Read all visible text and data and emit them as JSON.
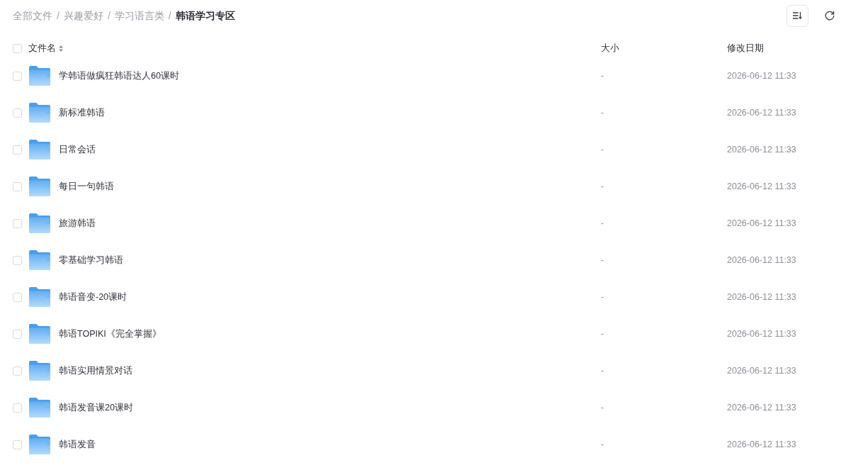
{
  "breadcrumb": {
    "separator": "/",
    "items": [
      {
        "label": "全部文件",
        "current": false
      },
      {
        "label": "兴趣爱好",
        "current": false
      },
      {
        "label": "学习语言类",
        "current": false
      },
      {
        "label": "韩语学习专区",
        "current": true
      }
    ]
  },
  "table": {
    "select_all": {
      "checked": false
    },
    "columns": [
      {
        "label": "文件名",
        "sortable": true
      },
      {
        "label": "大小",
        "sortable": false
      },
      {
        "label": "修改日期",
        "sortable": false
      }
    ],
    "rows": [
      {
        "name": "学韩语做疯狂韩语达人60课时",
        "size": "-",
        "modified": "2026-06-12 11:33",
        "checked": false
      },
      {
        "name": "新标准韩语",
        "size": "-",
        "modified": "2026-06-12 11:33",
        "checked": false
      },
      {
        "name": "日常会话",
        "size": "-",
        "modified": "2026-06-12 11:33",
        "checked": false
      },
      {
        "name": "每日一句韩语",
        "size": "-",
        "modified": "2026-06-12 11:33",
        "checked": false
      },
      {
        "name": "旅游韩语",
        "size": "-",
        "modified": "2026-06-12 11:33",
        "checked": false
      },
      {
        "name": "零基础学习韩语",
        "size": "-",
        "modified": "2026-06-12 11:33",
        "checked": false
      },
      {
        "name": "韩语音变-20课时",
        "size": "-",
        "modified": "2026-06-12 11:33",
        "checked": false
      },
      {
        "name": "韩语TOPIKI《完全掌握》",
        "size": "-",
        "modified": "2026-06-12 11:33",
        "checked": false
      },
      {
        "name": "韩语实用情景对话",
        "size": "-",
        "modified": "2026-06-12 11:33",
        "checked": false
      },
      {
        "name": "韩语发音课20课时",
        "size": "-",
        "modified": "2026-06-12 11:33",
        "checked": false
      },
      {
        "name": "韩语发音",
        "size": "-",
        "modified": "2026-06-12 11:33",
        "checked": false
      }
    ]
  }
}
